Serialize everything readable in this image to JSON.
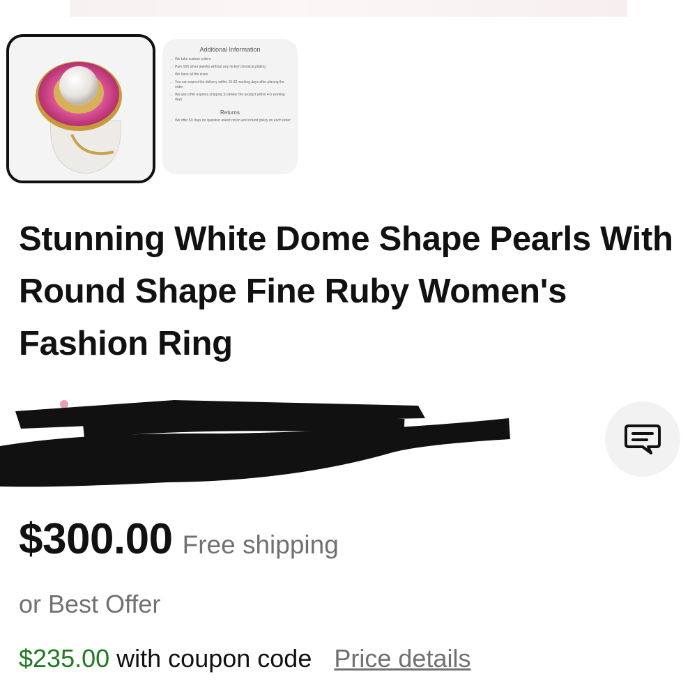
{
  "gallery": {
    "thumbnails": [
      {
        "label": "ring-photo",
        "selected": true
      },
      {
        "label": "info-card",
        "selected": false
      }
    ],
    "info_card": {
      "heading": "Additional Information",
      "lines": [
        "We take custom orders",
        "Pure 925 silver jewelry without any nickel/ chemical plating",
        "We have all the sizes",
        "You can expect the delivery within 15-30 working days after placing the order",
        "We also offer express shipping to deliver the product within 4-5 working days"
      ],
      "returns_heading": "Returns",
      "returns_lines": [
        "We offer 60 days no question asked return and refund policy on each order"
      ]
    }
  },
  "listing": {
    "title": "Stunning White Dome Shape Pearls With Round Shape Fine Ruby Women's Fashion Ring",
    "price": "$300.00",
    "shipping": "Free shipping",
    "best_offer": "or Best Offer",
    "coupon_price": "$235.00",
    "coupon_text": "with coupon code",
    "price_details_link": "Price details"
  },
  "seller": {
    "redacted": true
  },
  "icons": {
    "chat": "chat-bubble-icon"
  },
  "colors": {
    "coupon_green": "#1f7a1f",
    "muted_text": "#707070",
    "redaction": "#111111"
  }
}
